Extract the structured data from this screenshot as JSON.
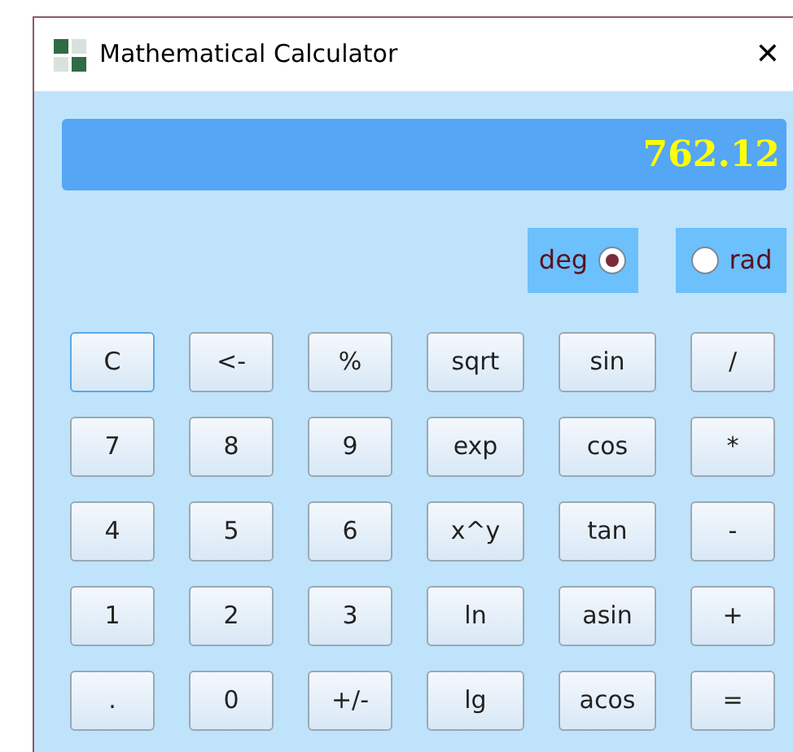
{
  "window": {
    "title": "Mathematical Calculator",
    "close": "✕"
  },
  "display": {
    "value": "762.12"
  },
  "angle_modes": [
    {
      "label": "deg",
      "selected": true
    },
    {
      "label": "rad",
      "selected": false
    }
  ],
  "buttons": [
    {
      "label": "C",
      "focused": true
    },
    {
      "label": "<-",
      "focused": false
    },
    {
      "label": "%",
      "focused": false
    },
    {
      "label": "sqrt",
      "focused": false
    },
    {
      "label": "sin",
      "focused": false
    },
    {
      "label": "/",
      "focused": false
    },
    {
      "label": "7",
      "focused": false
    },
    {
      "label": "8",
      "focused": false
    },
    {
      "label": "9",
      "focused": false
    },
    {
      "label": "exp",
      "focused": false
    },
    {
      "label": "cos",
      "focused": false
    },
    {
      "label": "*",
      "focused": false
    },
    {
      "label": "4",
      "focused": false
    },
    {
      "label": "5",
      "focused": false
    },
    {
      "label": "6",
      "focused": false
    },
    {
      "label": "x^y",
      "focused": false
    },
    {
      "label": "tan",
      "focused": false
    },
    {
      "label": "-",
      "focused": false
    },
    {
      "label": "1",
      "focused": false
    },
    {
      "label": "2",
      "focused": false
    },
    {
      "label": "3",
      "focused": false
    },
    {
      "label": "ln",
      "focused": false
    },
    {
      "label": "asin",
      "focused": false
    },
    {
      "label": "+",
      "focused": false
    },
    {
      "label": ".",
      "focused": false
    },
    {
      "label": "0",
      "focused": false
    },
    {
      "label": "+/-",
      "focused": false
    },
    {
      "label": "lg",
      "focused": false
    },
    {
      "label": "acos",
      "focused": false
    },
    {
      "label": "=",
      "focused": false
    }
  ]
}
